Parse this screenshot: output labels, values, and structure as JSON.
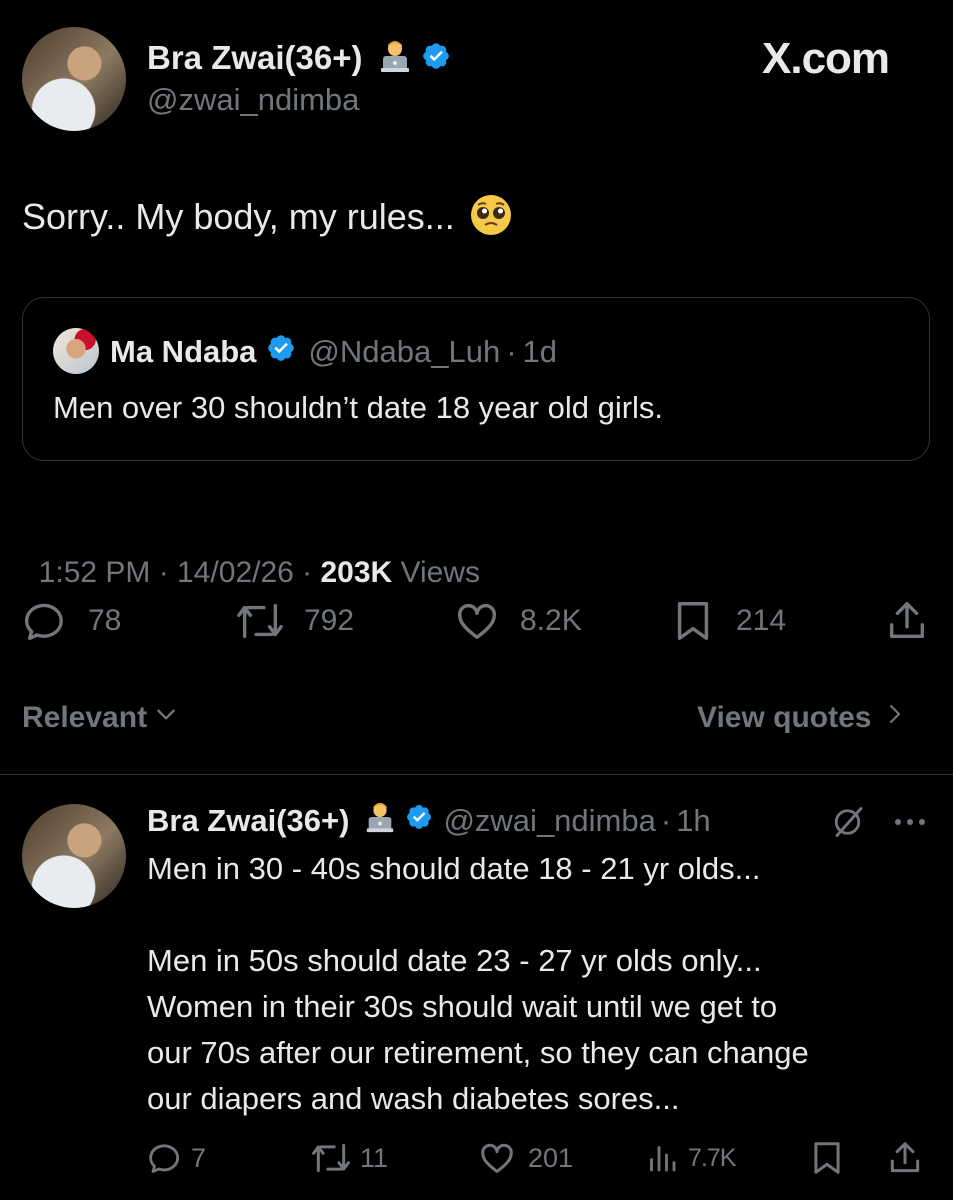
{
  "post": {
    "author_name": "Bra Zwai(36+)",
    "author_handle": "@zwai_ndimba",
    "site_logo": "X.com",
    "text": "Sorry.. My body, my rules...",
    "quoted": {
      "author_name": "Ma Ndaba",
      "author_handle": "@Ndaba_Luh",
      "age": "1d",
      "text": "Men over 30 shouldn’t date 18 year old girls."
    },
    "timestamp": "1:52 PM · 14/02/26 · ",
    "views_count": "203K",
    "views_label": " Views",
    "actions": {
      "replies": "78",
      "reposts": "792",
      "likes": "8.2K",
      "bookmarks": "214"
    }
  },
  "sort": {
    "label": "Relevant",
    "view_quotes": "View quotes"
  },
  "reply": {
    "author_name": "Bra Zwai(36+)",
    "author_handle": "@zwai_ndimba",
    "age": "1h",
    "line1": "Men in 30 - 40s should date 18 - 21 yr olds...",
    "para1": "Men in 50s should date 23 - 27 yr olds only...",
    "para2": "Women in their 30s should wait until we get to",
    "para3": "our 70s after our retirement, so they can change",
    "para4": "our diapers and wash diabetes sores...",
    "actions": {
      "replies": "7",
      "reposts": "11",
      "likes": "201",
      "views": "7.7K"
    }
  },
  "colors": {
    "background": "#000000",
    "text": "#e7e9ea",
    "muted": "#71767b",
    "verified": "#1d9bf0",
    "divider": "#2f3336"
  },
  "icons": [
    "verified-badge-icon",
    "technologist-emoji-icon",
    "pleading-face-emoji-icon",
    "reply-icon",
    "repost-icon",
    "like-icon",
    "bookmark-icon",
    "share-icon",
    "chevron-down-icon",
    "chevron-right-icon",
    "grok-icon",
    "more-icon",
    "views-icon"
  ]
}
